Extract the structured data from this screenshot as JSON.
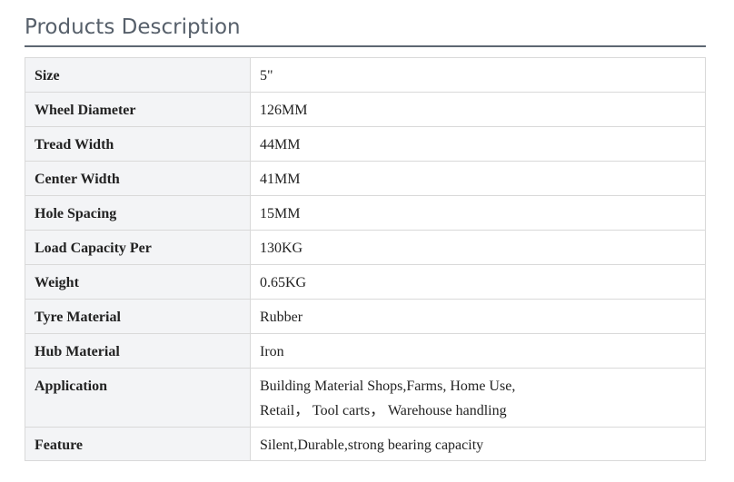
{
  "section": {
    "title": "Products Description"
  },
  "specs": [
    {
      "label": "Size",
      "value": "5\""
    },
    {
      "label": "Wheel Diameter",
      "value": "126MM"
    },
    {
      "label": "Tread Width",
      "value": "44MM"
    },
    {
      "label": "Center Width",
      "value": "41MM"
    },
    {
      "label": "Hole Spacing",
      "value": "15MM"
    },
    {
      "label": "Load Capacity Per",
      "value": "130KG"
    },
    {
      "label": "Weight",
      "value": "0.65KG"
    },
    {
      "label": "Tyre Material",
      "value": "Rubber"
    },
    {
      "label": "Hub Material",
      "value": "Iron"
    },
    {
      "label": "Application",
      "value_line1": "Building Material Shops,Farms, Home Use,",
      "value_line2": "Retail，  Tool carts，  Warehouse handling"
    },
    {
      "label": "Feature",
      "value": "Silent,Durable,strong bearing capacity"
    }
  ]
}
